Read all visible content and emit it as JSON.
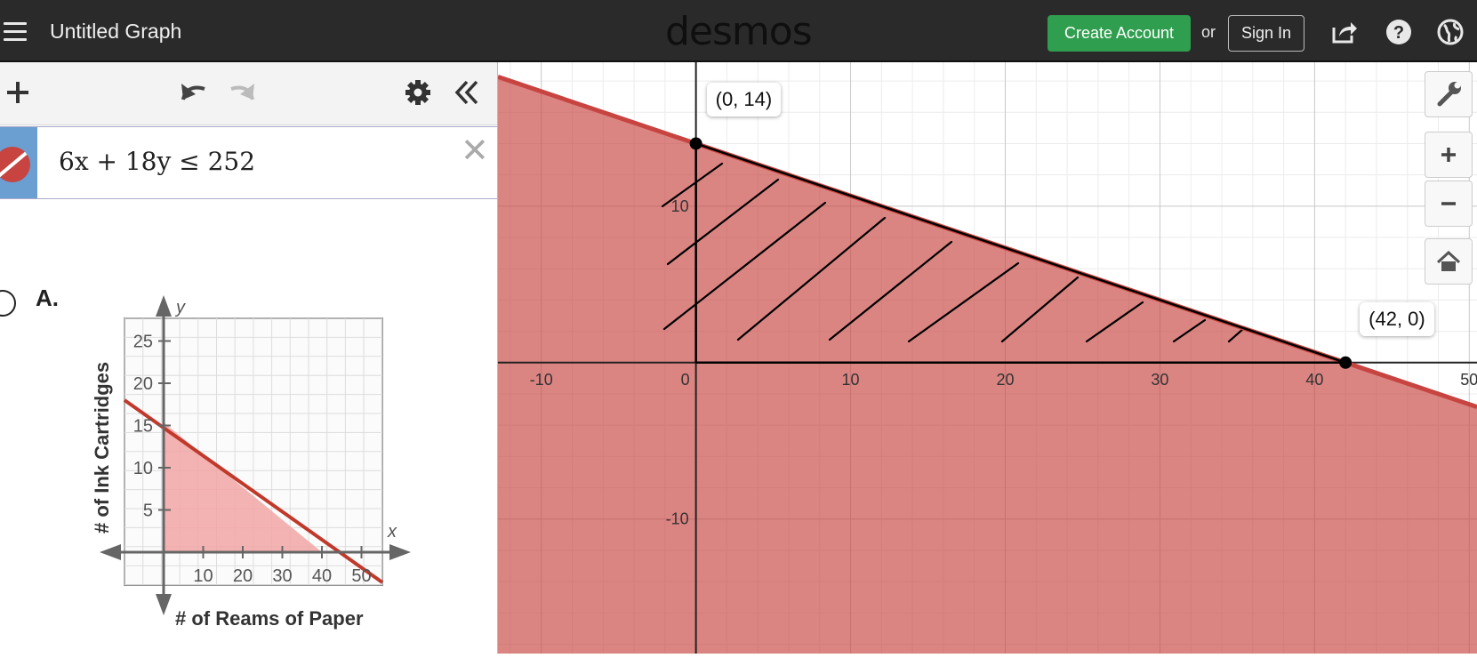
{
  "header": {
    "title": "Untitled Graph",
    "logo": "desmos",
    "create_account": "Create Account",
    "or": "or",
    "sign_in": "Sign In",
    "icons": [
      "share-icon",
      "help-icon",
      "globe-icon"
    ]
  },
  "expression": {
    "text": "6x + 18y ≤ 252",
    "color": "#c74440"
  },
  "option": {
    "label": "A."
  },
  "thumbnail": {
    "ylabel": "# of Ink Cartridges",
    "xlabel": "# of Reams of Paper",
    "y_axis_letter": "y",
    "x_axis_letter": "x",
    "y_ticks": [
      "25",
      "20",
      "15",
      "10",
      "5"
    ],
    "x_ticks": [
      "10",
      "20",
      "30",
      "40",
      "50"
    ]
  },
  "graph": {
    "point_labels": [
      "(0, 14)",
      "(42, 0)"
    ],
    "x_ticks": [
      "-10",
      "0",
      "10",
      "20",
      "30",
      "40",
      "50"
    ],
    "y_ticks": [
      "10",
      "-10"
    ],
    "shade_color": "#c74440"
  },
  "chart_data": {
    "type": "line",
    "title": "",
    "xlabel": "",
    "ylabel": "",
    "xlim": [
      -12.8,
      50.5
    ],
    "ylim": [
      -18.6,
      19.2
    ],
    "series": [
      {
        "x": [
          0,
          42
        ],
        "y": [
          14,
          0
        ]
      }
    ],
    "points": [
      {
        "x": 0,
        "y": 14,
        "label": "(0, 14)"
      },
      {
        "x": 42,
        "y": 0,
        "label": "(42, 0)"
      }
    ],
    "shaded_region": "y <= 14 - x/3",
    "grid": true
  }
}
